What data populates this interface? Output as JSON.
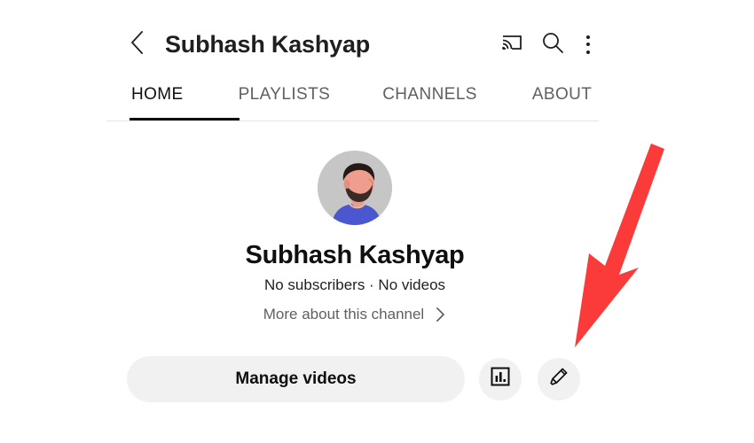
{
  "appbar": {
    "back_icon": "chevron-left-icon",
    "title": "Subhash Kashyap",
    "cast_icon": "cast-icon",
    "search_icon": "search-icon",
    "menu_icon": "more-vertical-icon"
  },
  "tabs": [
    {
      "label": "HOME",
      "active": true
    },
    {
      "label": "PLAYLISTS",
      "active": false
    },
    {
      "label": "CHANNELS",
      "active": false
    },
    {
      "label": "ABOUT",
      "active": false
    }
  ],
  "channel": {
    "avatar_alt": "channel-avatar",
    "name": "Subhash Kashyap",
    "meta": "No subscribers · No videos",
    "more_link": "More about this channel",
    "more_chevron_icon": "chevron-right-icon"
  },
  "actions": {
    "manage_videos": "Manage videos",
    "analytics_icon": "analytics-bar-chart-icon",
    "edit_icon": "pencil-edit-icon"
  },
  "annotation": {
    "arrow_icon": "red-arrow-pointing-to-edit-button",
    "arrow_color": "#fb3b39"
  },
  "colors": {
    "background": "#ffffff",
    "text_primary": "#0f0f0f",
    "text_secondary": "#606060",
    "button_fill": "#f1f1f1",
    "divider": "#e5e5e5",
    "accent_red": "#fb3b39"
  }
}
